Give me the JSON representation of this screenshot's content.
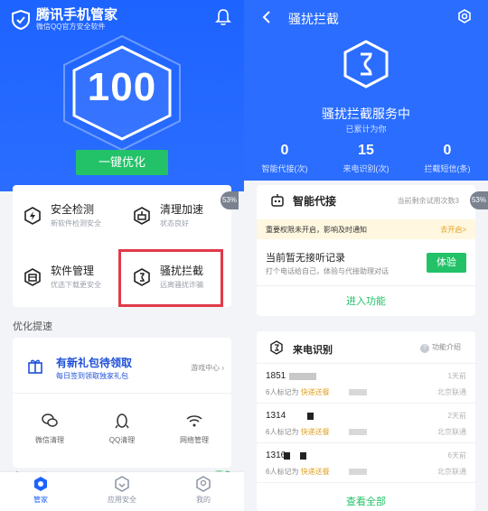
{
  "left": {
    "app_title": "腾讯手机管家",
    "app_subtitle": "微信QQ官方安全软件",
    "score": "100",
    "optimize_label": "一键优化",
    "features": [
      {
        "title": "安全检测",
        "sub": "新软件检测安全"
      },
      {
        "title": "清理加速",
        "sub": "状态良好"
      },
      {
        "title": "软件管理",
        "sub": "优选下载更安全"
      },
      {
        "title": "骚扰拦截",
        "sub": "远离骚扰诈骗"
      }
    ],
    "badge_pct": "53%",
    "section_title": "优化提速",
    "gift": {
      "title": "有新礼包待领取",
      "sub": "每日签到领取独家礼包",
      "link": "游戏中心"
    },
    "tools": [
      "微信清理",
      "QQ清理",
      "网络管理"
    ],
    "cut_section": "实用工具",
    "cut_more": "更多",
    "tabs": [
      "管家",
      "应用安全",
      "我的"
    ]
  },
  "right": {
    "title": "骚扰拦截",
    "status": "骚扰拦截服务中",
    "accumulated": "已累计为你",
    "stats": [
      {
        "value": "0",
        "label": "智能代接(次)"
      },
      {
        "value": "15",
        "label": "来电识别(次)"
      },
      {
        "value": "0",
        "label": "拦截短信(条)"
      }
    ],
    "smart": {
      "title": "智能代接",
      "remaining": "当前剩余试用次数3",
      "badge_pct": "53%",
      "warn_text": "重要权限未开启，影响及时通知",
      "warn_link": "去开启>",
      "no_record_title": "当前暂无接听记录",
      "no_record_sub": "打个电话给自己，体验与代接助理对话",
      "try_label": "体验",
      "enter_label": "进入功能"
    },
    "caller": {
      "title": "来电识别",
      "help": "功能介绍",
      "rows": [
        {
          "number": "1851",
          "marked_prefix": "6人标记为",
          "marked_tag": "快递送餐",
          "when": "1天前",
          "operator": "北京联通"
        },
        {
          "number": "1314",
          "marked_prefix": "6人标记为",
          "marked_tag": "快递送餐",
          "when": "2天前",
          "operator": "北京联通"
        },
        {
          "number": "1316",
          "marked_prefix": "6人标记为",
          "marked_tag": "快递送餐",
          "when": "6天前",
          "operator": "北京联通"
        }
      ],
      "view_all": "查看全部"
    }
  },
  "colors": {
    "brand_blue": "#2a6dff",
    "green": "#23c268",
    "highlight_red": "#e03a4a",
    "tag_orange": "#e0a020"
  }
}
